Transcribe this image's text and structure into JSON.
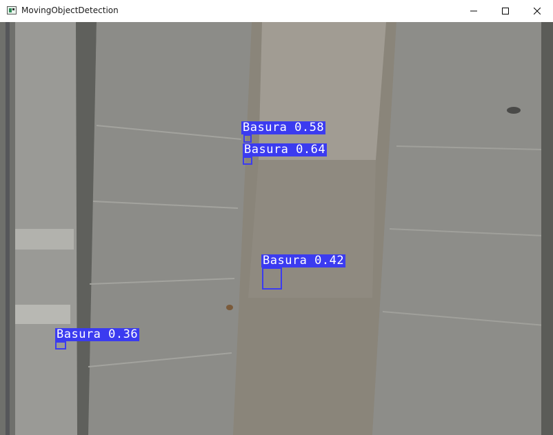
{
  "window": {
    "title": "MovingObjectDetection",
    "icons": {
      "app": "app-icon",
      "minimize": "minimize-icon",
      "maximize": "maximize-icon",
      "close": "close-icon"
    }
  },
  "detections": [
    {
      "label": "Basura 0.58",
      "class": "Basura",
      "confidence": 0.58
    },
    {
      "label": "Basura 0.64",
      "class": "Basura",
      "confidence": 0.64
    },
    {
      "label": "Basura 0.42",
      "class": "Basura",
      "confidence": 0.42
    },
    {
      "label": "Basura 0.36",
      "class": "Basura",
      "confidence": 0.36
    }
  ],
  "colors": {
    "box": "#3b3bf0",
    "label_text": "#ffffff"
  }
}
